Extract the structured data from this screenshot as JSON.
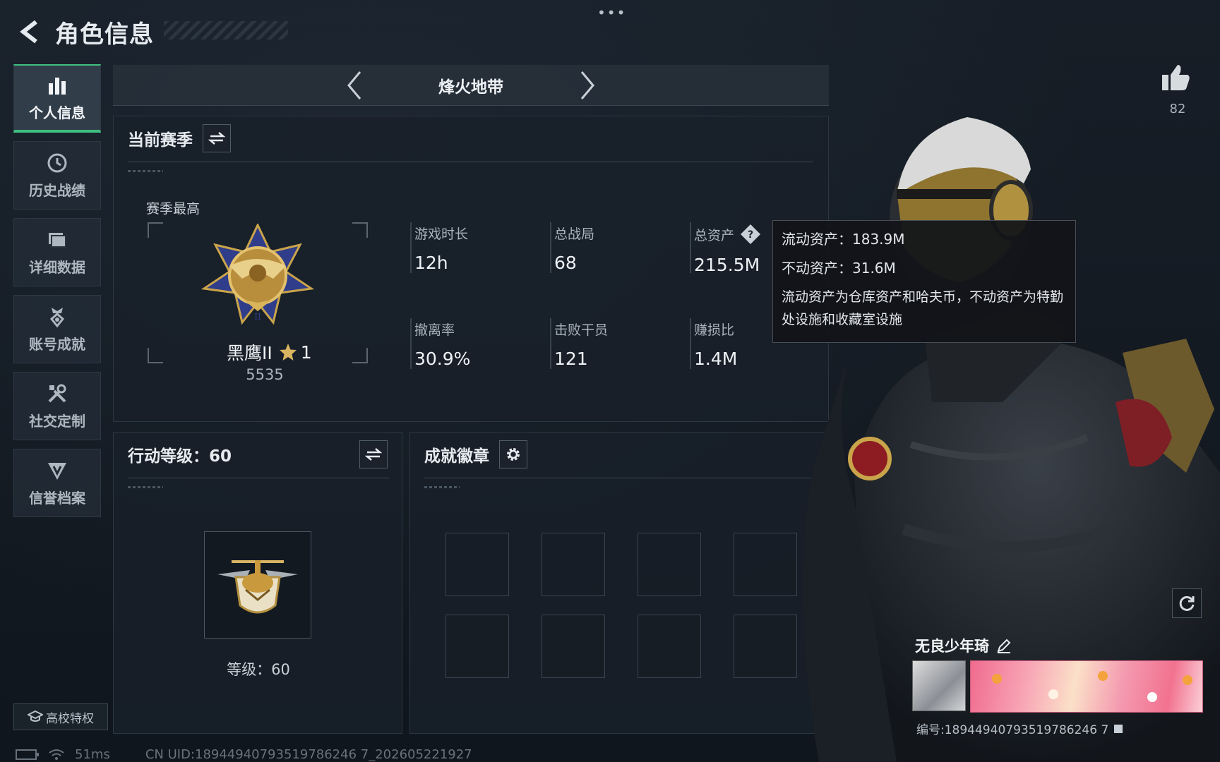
{
  "header": {
    "title": "角色信息"
  },
  "top_dots": "•••",
  "sidebar": {
    "items": [
      {
        "label": "个人信息",
        "icon": "bar-chart-icon"
      },
      {
        "label": "历史战绩",
        "icon": "history-clock-icon"
      },
      {
        "label": "详细数据",
        "icon": "folder-icon"
      },
      {
        "label": "账号成就",
        "icon": "achievement-medal-icon"
      },
      {
        "label": "社交定制",
        "icon": "tools-icon"
      },
      {
        "label": "信誉档案",
        "icon": "shield-emblem-icon"
      }
    ],
    "campus_label": "高校特权"
  },
  "mode_selector": {
    "name": "烽火地带"
  },
  "season_panel": {
    "title": "当前赛季",
    "best_label": "赛季最高",
    "rank_name": "黑鹰II",
    "rank_stars": "1",
    "rank_score": "5535",
    "stats": [
      {
        "label": "游戏时长",
        "value": "12h"
      },
      {
        "label": "总战局",
        "value": "68"
      },
      {
        "label": "总资产",
        "value": "215.5M"
      },
      {
        "label": "撤离率",
        "value": "30.9%"
      },
      {
        "label": "击败干员",
        "value": "121"
      },
      {
        "label": "赚损比",
        "value": "1.4M"
      }
    ]
  },
  "tooltip": {
    "liquid": "流动资产：183.9M",
    "fixed": "不动资产：31.6M",
    "description": "流动资产为仓库资产和哈夫币，不动资产为特勤处设施和收藏室设施"
  },
  "action_panel": {
    "title": "行动等级：60",
    "level_text": "等级：60"
  },
  "badge_panel": {
    "title": "成就徽章"
  },
  "character": {
    "like_count": "82",
    "player_name": "无良少年琦",
    "player_id": "编号:18944940793519786246 7"
  },
  "footer": {
    "ping": "51ms",
    "uid": "CN UID:18944940793519786246 7_202605221927"
  },
  "colors": {
    "accent_green": "#3fbf7f",
    "background": "#121820",
    "panel": "#19202a"
  }
}
